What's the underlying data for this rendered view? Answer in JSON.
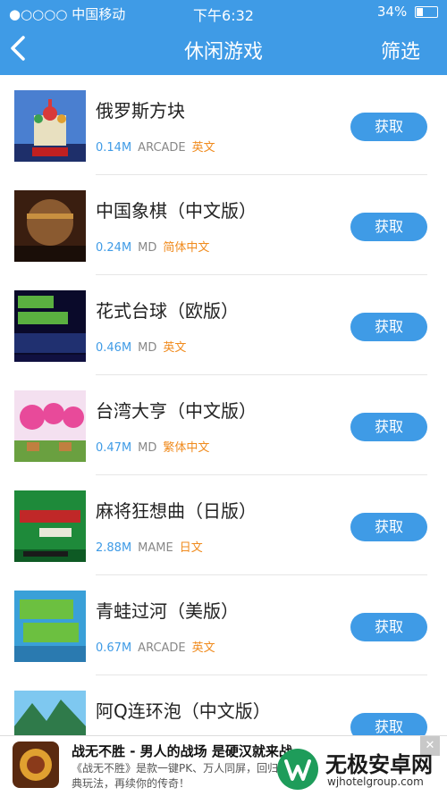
{
  "status_bar": {
    "carrier": "●○○○○ 中国移动",
    "time": "下午6:32",
    "battery": "34%",
    "battery_level": 0.34
  },
  "header": {
    "title": "休闲游戏",
    "filter_label": "筛选"
  },
  "games": [
    {
      "name": "俄罗斯方块",
      "size": "0.14M",
      "platform": "ARCADE",
      "language": "英文",
      "action": "获取",
      "thumb": "tetris-thumbnail"
    },
    {
      "name": "中国象棋（中文版）",
      "size": "0.24M",
      "platform": "MD",
      "language": "简体中文",
      "action": "获取",
      "thumb": "chinese-chess-thumbnail"
    },
    {
      "name": "花式台球（欧版）",
      "size": "0.46M",
      "platform": "MD",
      "language": "英文",
      "action": "获取",
      "thumb": "side-pocket-thumbnail"
    },
    {
      "name": "台湾大亨（中文版）",
      "size": "0.47M",
      "platform": "MD",
      "language": "繁体中文",
      "action": "获取",
      "thumb": "taiwan-tycoon-thumbnail"
    },
    {
      "name": "麻将狂想曲（日版）",
      "size": "2.88M",
      "platform": "MAME",
      "language": "日文",
      "action": "获取",
      "thumb": "mahjong-thumbnail"
    },
    {
      "name": "青蛙过河（美版）",
      "size": "0.67M",
      "platform": "ARCADE",
      "language": "英文",
      "action": "获取",
      "thumb": "frog-feast-thumbnail"
    },
    {
      "name": "阿Q连环泡（中文版）",
      "size": "",
      "platform": "",
      "language": "",
      "action": "获取",
      "thumb": "bubble-thumbnail"
    }
  ],
  "ad": {
    "title": "战无不胜 - 男人的战场 是硬汉就来战",
    "description": "《战无不胜》是款一键PK、万人同屏，回归经典玩法，再续你的传奇！",
    "close": "✕"
  },
  "watermark": {
    "text": "无极安卓网",
    "url": "wjhotelgroup.com"
  },
  "colors": {
    "accent": "#3f9be6",
    "language": "#f08a1c"
  }
}
